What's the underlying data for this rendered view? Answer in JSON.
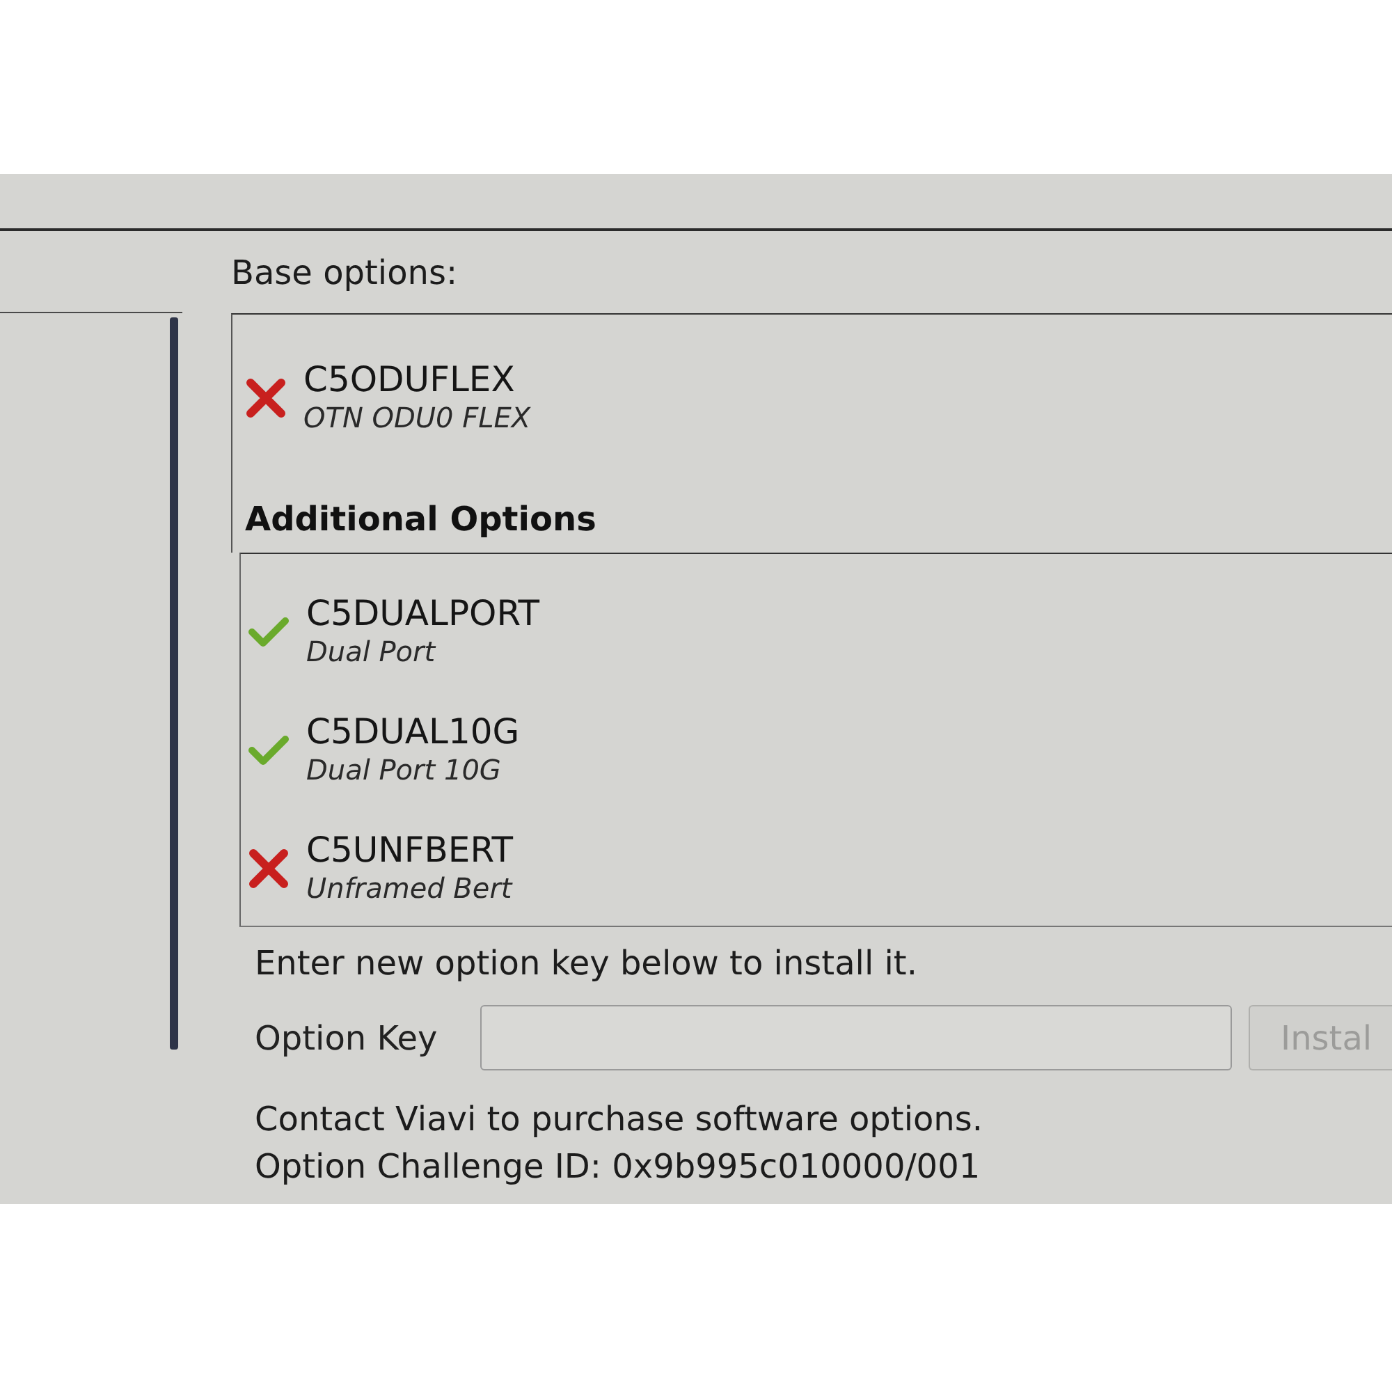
{
  "base_options": {
    "title": "Base options:",
    "items": [
      {
        "code": "C5ODUFLEX",
        "description": "OTN ODU0 FLEX",
        "installed": false
      }
    ]
  },
  "additional_options": {
    "title": "Additional Options",
    "items": [
      {
        "code": "C5DUALPORT",
        "description": "Dual Port",
        "installed": true
      },
      {
        "code": "C5DUAL10G",
        "description": "Dual Port 10G",
        "installed": true
      },
      {
        "code": "C5UNFBERT",
        "description": "Unframed Bert",
        "installed": false
      }
    ]
  },
  "install": {
    "instruction": "Enter new option key below to install it.",
    "field_label": "Option Key",
    "button": {
      "label": "Instal",
      "disabled": true
    }
  },
  "footer_lines": [
    "Contact Viavi to purchase software options.",
    "Option Challenge ID: 0x9b995c010000/001"
  ]
}
